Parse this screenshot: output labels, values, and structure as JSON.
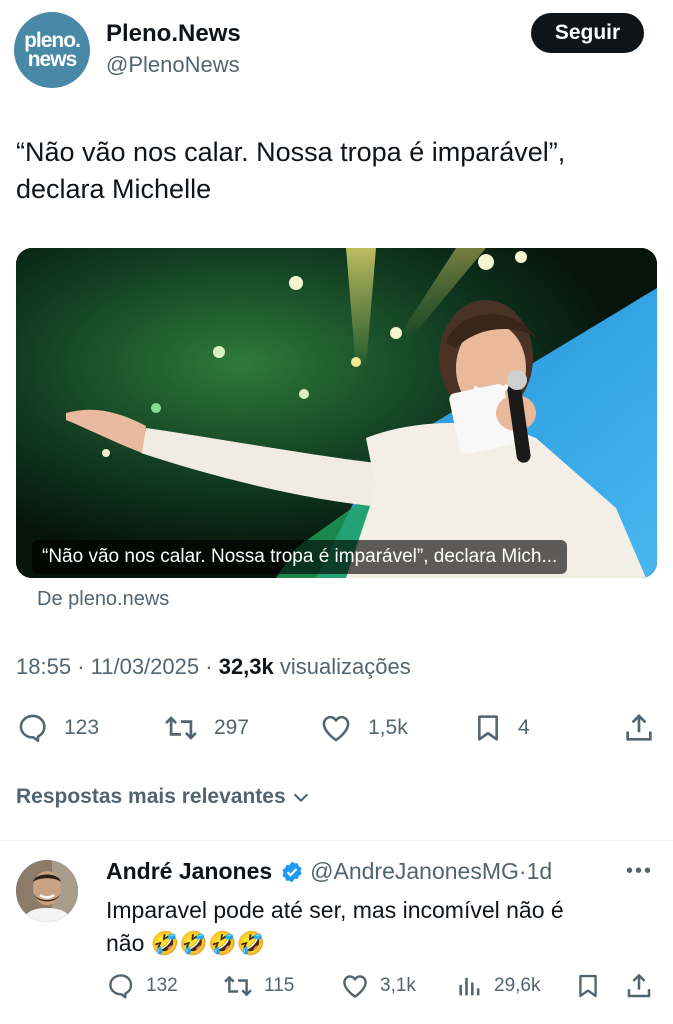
{
  "account": {
    "avatar_line1": "pleno.",
    "avatar_line2": "news",
    "name": "Pleno.News",
    "handle": "@PlenoNews",
    "follow_label": "Seguir"
  },
  "tweet": {
    "text_line1": "“Não vão nos calar. Nossa tropa é imparável”,",
    "text_line2": "declara Michelle",
    "media_caption": "“Não vão nos calar. Nossa tropa é imparável”, declara Mich...",
    "link_source": "De pleno.news",
    "time": "18:55",
    "date": "11/03/2025",
    "views_count": "32,3k",
    "views_label": "visualizações"
  },
  "actions": {
    "replies": "123",
    "retweets": "297",
    "likes": "1,5k",
    "bookmarks": "4"
  },
  "replies_section": {
    "sort_label": "Respostas mais relevantes"
  },
  "reply": {
    "name": "André Janones",
    "handle": "@AndreJanonesMG",
    "time": "1d",
    "text_line1": "Imparavel pode até ser, mas incomível não é",
    "text_line2": "não",
    "emoji": "🤣🤣🤣🤣",
    "replies": "132",
    "retweets": "115",
    "likes": "3,1k",
    "views": "29,6k"
  },
  "colors": {
    "text_primary": "#0f1419",
    "text_secondary": "#536471",
    "verified_blue": "#1d9bf0",
    "pleno_brand": "#4a88a8"
  }
}
